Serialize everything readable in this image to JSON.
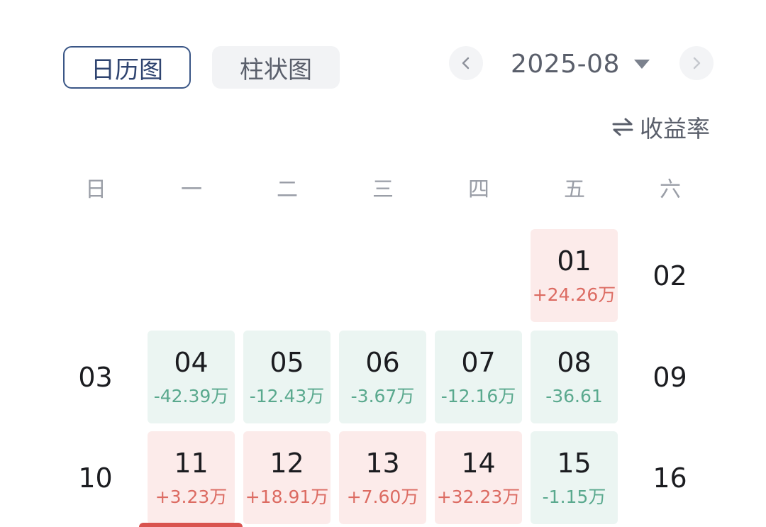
{
  "tabs": {
    "calendar": "日历图",
    "bar": "柱状图"
  },
  "month": {
    "label": "2025-08"
  },
  "metric_toggle": {
    "label": "收益率"
  },
  "weekdays": [
    "日",
    "一",
    "二",
    "三",
    "四",
    "五",
    "六"
  ],
  "days": [
    {
      "day": "01",
      "amount": "+24.26万"
    },
    {
      "day": "02"
    },
    {
      "day": "03"
    },
    {
      "day": "04",
      "amount": "-42.39万"
    },
    {
      "day": "05",
      "amount": "-12.43万"
    },
    {
      "day": "06",
      "amount": "-3.67万"
    },
    {
      "day": "07",
      "amount": "-12.16万"
    },
    {
      "day": "08",
      "amount": "-36.61"
    },
    {
      "day": "09"
    },
    {
      "day": "10"
    },
    {
      "day": "11",
      "amount": "+3.23万"
    },
    {
      "day": "12",
      "amount": "+18.91万"
    },
    {
      "day": "13",
      "amount": "+7.60万"
    },
    {
      "day": "14",
      "amount": "+32.23万"
    },
    {
      "day": "15",
      "amount": "-1.15万"
    },
    {
      "day": "16"
    }
  ],
  "colors": {
    "gain": "#dc6b62",
    "loss": "#5aa98e",
    "gain_bg": "#fcebea",
    "loss_bg": "#ebf5f2",
    "accent": "#3a5686"
  },
  "icons": {
    "prev": "chevron-left-icon",
    "next": "chevron-right-icon",
    "dropdown": "caret-down-icon",
    "swap": "swap-arrows-icon"
  }
}
